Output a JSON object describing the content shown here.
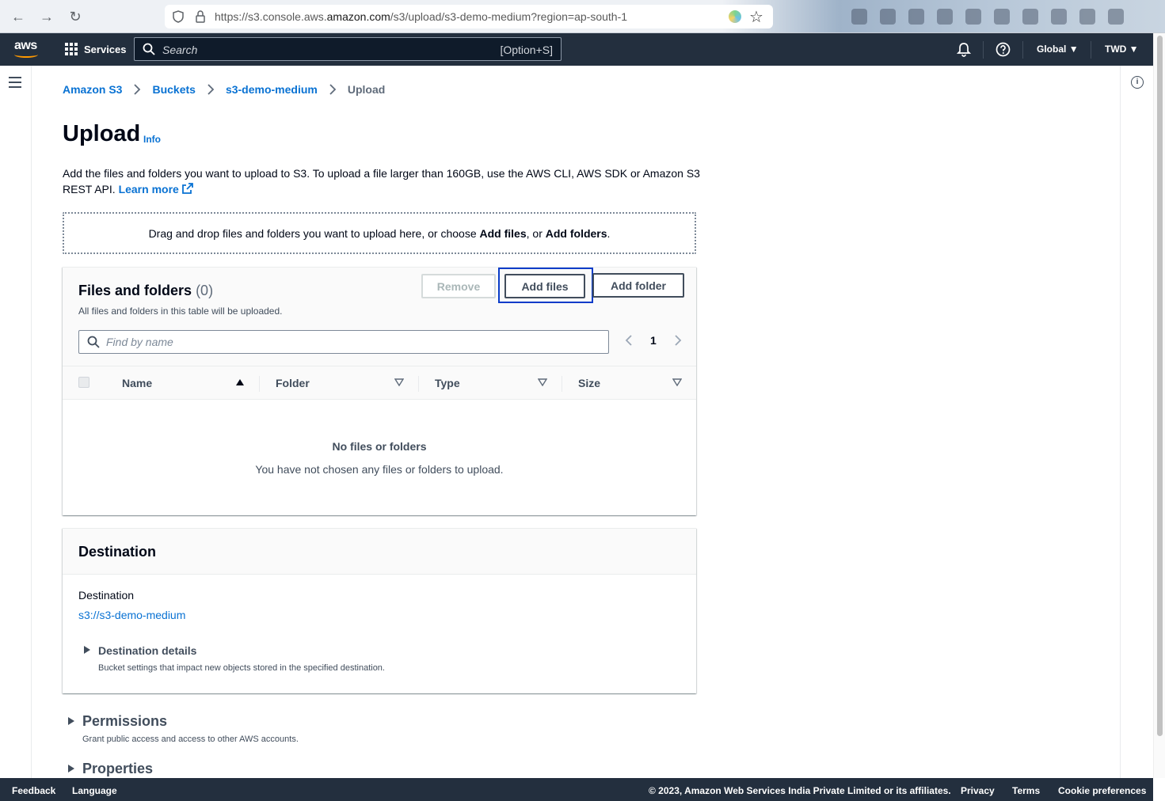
{
  "browser": {
    "url_prefix": "https://s3.console.aws.",
    "url_domain": "amazon.com",
    "url_path": "/s3/upload/s3-demo-medium?region=ap-south-1"
  },
  "topnav": {
    "logo_text": "aws",
    "services_label": "Services",
    "search_placeholder": "Search",
    "search_shortcut": "[Option+S]",
    "region_label": "Global",
    "account_label": "TWD"
  },
  "breadcrumbs": [
    {
      "label": "Amazon S3"
    },
    {
      "label": "Buckets"
    },
    {
      "label": "s3-demo-medium"
    },
    {
      "label": "Upload"
    }
  ],
  "page": {
    "title": "Upload",
    "info_label": "Info",
    "description": "Add the files and folders you want to upload to S3. To upload a file larger than 160GB, use the AWS CLI, AWS SDK or Amazon S3 REST API.",
    "learn_more": "Learn more"
  },
  "dropzone": {
    "text_before": "Drag and drop files and folders you want to upload here, or choose ",
    "add_files": "Add files",
    "middle": ", or ",
    "add_folders": "Add folders",
    "end": "."
  },
  "files_panel": {
    "title": "Files and folders",
    "count": "(0)",
    "subtitle": "All files and folders in this table will be uploaded.",
    "remove_label": "Remove",
    "add_files_label": "Add files",
    "add_folder_label": "Add folder",
    "find_placeholder": "Find by name",
    "current_page": "1",
    "columns": [
      "Name",
      "Folder",
      "Type",
      "Size"
    ],
    "empty_title": "No files or folders",
    "empty_message": "You have not chosen any files or folders to upload."
  },
  "destination": {
    "title": "Destination",
    "label": "Destination",
    "uri": "s3://s3-demo-medium",
    "details_title": "Destination details",
    "details_sub": "Bucket settings that impact new objects stored in the specified destination."
  },
  "permissions": {
    "title": "Permissions",
    "sub": "Grant public access and access to other AWS accounts."
  },
  "properties": {
    "title": "Properties"
  },
  "footer": {
    "feedback": "Feedback",
    "language": "Language",
    "copyright": "© 2023, Amazon Web Services India Private Limited or its affiliates.",
    "privacy": "Privacy",
    "terms": "Terms",
    "cookies": "Cookie preferences"
  },
  "colors": {
    "link": "#0972d3",
    "nav_bg": "#232f3e",
    "focus_ring": "#0a3cc9",
    "aws_orange": "#ff9900"
  }
}
